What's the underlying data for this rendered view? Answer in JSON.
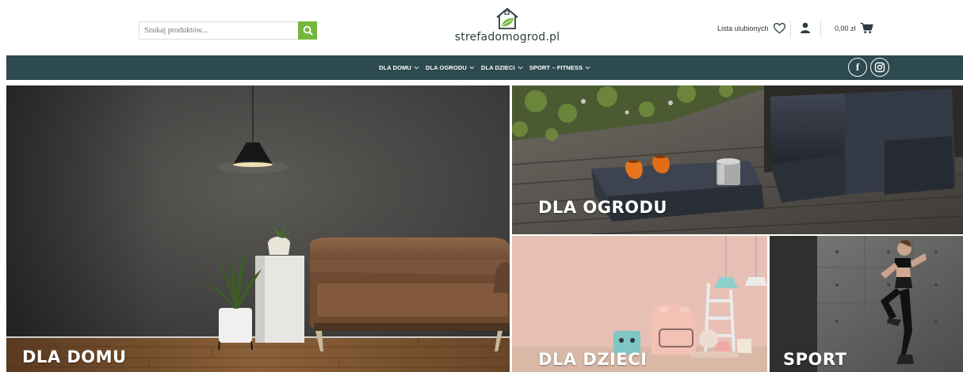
{
  "search": {
    "placeholder": "Szukaj produktów..."
  },
  "logo": {
    "text": "strefadomogrod.pl"
  },
  "header": {
    "wishlist_label": "Lista ulubionych",
    "cart_total": "0,00 zł"
  },
  "nav": {
    "items": [
      {
        "label": "DLA DOMU"
      },
      {
        "label": "DLA OGRODU"
      },
      {
        "label": "DLA DZIECI"
      },
      {
        "label": "SPORT – FITNESS"
      }
    ]
  },
  "social": [
    "facebook-icon",
    "instagram-icon"
  ],
  "banners": {
    "home": {
      "label": "DLA DOMU"
    },
    "garden": {
      "label": "DLA OGRODU"
    },
    "kids": {
      "label": "DLA DZIECI"
    },
    "sport": {
      "label": "SPORT"
    }
  },
  "colors": {
    "accent": "#73b73b",
    "nav_bg": "#2c4a4f"
  }
}
